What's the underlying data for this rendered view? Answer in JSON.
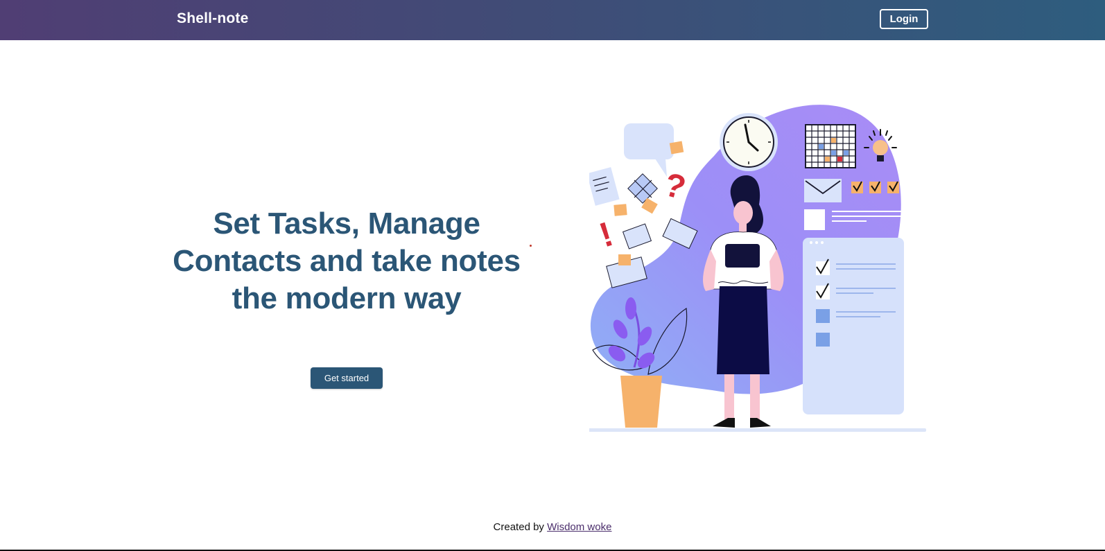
{
  "navbar": {
    "brand": "Shell-note",
    "login_label": "Login",
    "gradient": [
      "#503e74",
      "#2e5d7e"
    ]
  },
  "hero": {
    "title_lines": [
      "Set Tasks, Manage",
      "Contacts and take notes",
      "the modern way"
    ],
    "cta_label": "Get started",
    "accent": "#2b5676"
  },
  "illustration": {
    "icons": [
      "clock-icon",
      "calendar-icon",
      "lightbulb-icon",
      "envelope-icon",
      "question-mark-icon",
      "exclamation-icon",
      "checklist-icon",
      "plant-icon"
    ]
  },
  "footer": {
    "prefix": "Created by",
    "author_link": "Wisdom woke"
  }
}
